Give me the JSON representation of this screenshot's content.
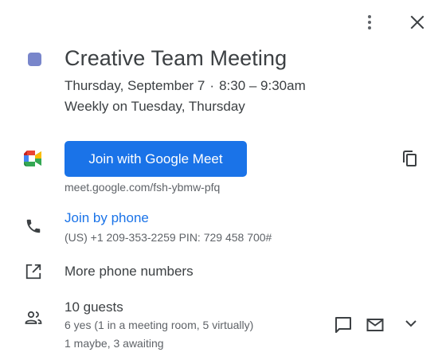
{
  "event": {
    "title": "Creative Team Meeting",
    "date": "Thursday, September 7",
    "separator": "·",
    "time": "8:30 – 9:30am",
    "recurrence": "Weekly on Tuesday, Thursday",
    "color": "#7986cb"
  },
  "meet": {
    "button_label": "Join with Google Meet",
    "url": "meet.google.com/fsh-ybmw-pfq",
    "accent": "#1a73e8"
  },
  "phone": {
    "link_label": "Join by phone",
    "details": "(US) +1 209-353-2259 PIN: 729 458 700#"
  },
  "more_phones": {
    "label": "More phone numbers"
  },
  "guests": {
    "title": "10 guests",
    "yes_line": "6 yes (1 in a meeting room, 5 virtually)",
    "other_line": "1 maybe, 3 awaiting"
  },
  "icons": {
    "more": "more-vert-icon",
    "close": "close-icon",
    "meet": "google-meet-icon",
    "copy": "copy-icon",
    "phone": "phone-icon",
    "open_new": "open-in-new-icon",
    "people": "people-icon",
    "chat": "chat-icon",
    "mail": "mail-icon",
    "expand": "chevron-down-icon"
  }
}
